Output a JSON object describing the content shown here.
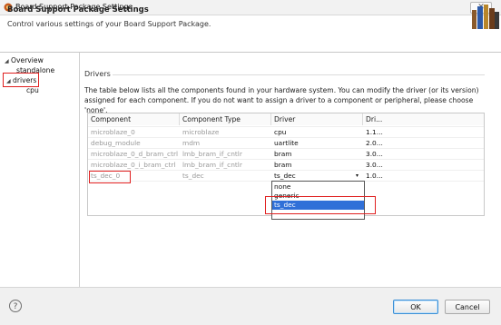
{
  "window": {
    "title": "Board Support Package Settings",
    "close_glyph": "✕"
  },
  "header": {
    "title": "Board Support Package Settings",
    "description": "Control various settings of your Board Support Package."
  },
  "tree": {
    "overview": "Overview",
    "standalone": "standalone",
    "drivers": "drivers",
    "cpu": "cpu"
  },
  "section": {
    "title": "Drivers",
    "description": "The table below lists all the components found in your hardware system. You can modify the driver (or its version) assigned for each component. If you do not want to assign a driver to a component or peripheral, please choose 'none'."
  },
  "table": {
    "headers": [
      "Component",
      "Component Type",
      "Driver",
      "Dri..."
    ],
    "rows": [
      {
        "component": "microblaze_0",
        "type": "microblaze",
        "driver": "cpu",
        "version": "1.1..."
      },
      {
        "component": "debug_module",
        "type": "mdm",
        "driver": "uartlite",
        "version": "2.0..."
      },
      {
        "component": "microblaze_0_d_bram_ctrl",
        "type": "lmb_bram_if_cntlr",
        "driver": "bram",
        "version": "3.0..."
      },
      {
        "component": "microblaze_0_i_bram_ctrl",
        "type": "lmb_bram_if_cntlr",
        "driver": "bram",
        "version": "3.0..."
      },
      {
        "component": "ts_dec_0",
        "type": "ts_dec",
        "driver": "ts_dec",
        "version": "1.0..."
      }
    ]
  },
  "dropdown": {
    "options": [
      "none",
      "generic",
      "ts_dec"
    ],
    "selected": "ts_dec"
  },
  "footer": {
    "help": "?",
    "ok": "OK",
    "cancel": "Cancel"
  },
  "colors": {
    "accent": "#3070d8",
    "highlight": "#e02020"
  }
}
